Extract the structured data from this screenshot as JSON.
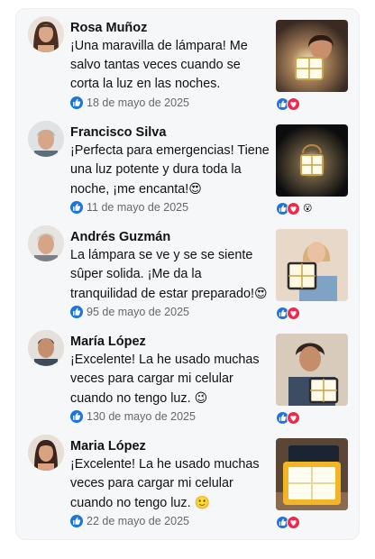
{
  "reviews": [
    {
      "name": "Rosa Muñoz",
      "text": "¡Una maravilla de lámpara! Me salvo tantas veces cuando se corta la luz en las noches.",
      "emoji": "",
      "date": "18 de mayo de 2025",
      "extra_reaction": ""
    },
    {
      "name": "Francisco Silva",
      "text": "¡Perfecta para emergencias! Tiene una luz potente y dura toda la noche, ¡me encanta!",
      "emoji": "😍",
      "date": "11 de mayo de 2025",
      "extra_reaction": "😮"
    },
    {
      "name": "Andrés Guzmán",
      "text": "La lámpara se ve y se se siente sûper solida. ¡Me da la tranquilidad de estar preparado!",
      "emoji": "😍",
      "date": "95 de mayo de 2025",
      "extra_reaction": ""
    },
    {
      "name": "María López",
      "text": "¡Excelente! La he usado muchas veces para cargar mi celular cuando no tengo luz.",
      "emoji": "😉",
      "date": "130 de mayo de 2025",
      "extra_reaction": ""
    },
    {
      "name": "Maria López",
      "text": "¡Excelente! La he usado muchas veces para cargar mi celular cuando no tengo luz.",
      "emoji": "🙂",
      "date": "22 de mayo de 2025",
      "extra_reaction": ""
    }
  ],
  "icons": {
    "like": "thumbs-up-icon",
    "love": "heart-icon"
  },
  "colors": {
    "like_blue": "#1b74e4",
    "love_red": "#f0284a",
    "date_gray": "#65676b"
  }
}
